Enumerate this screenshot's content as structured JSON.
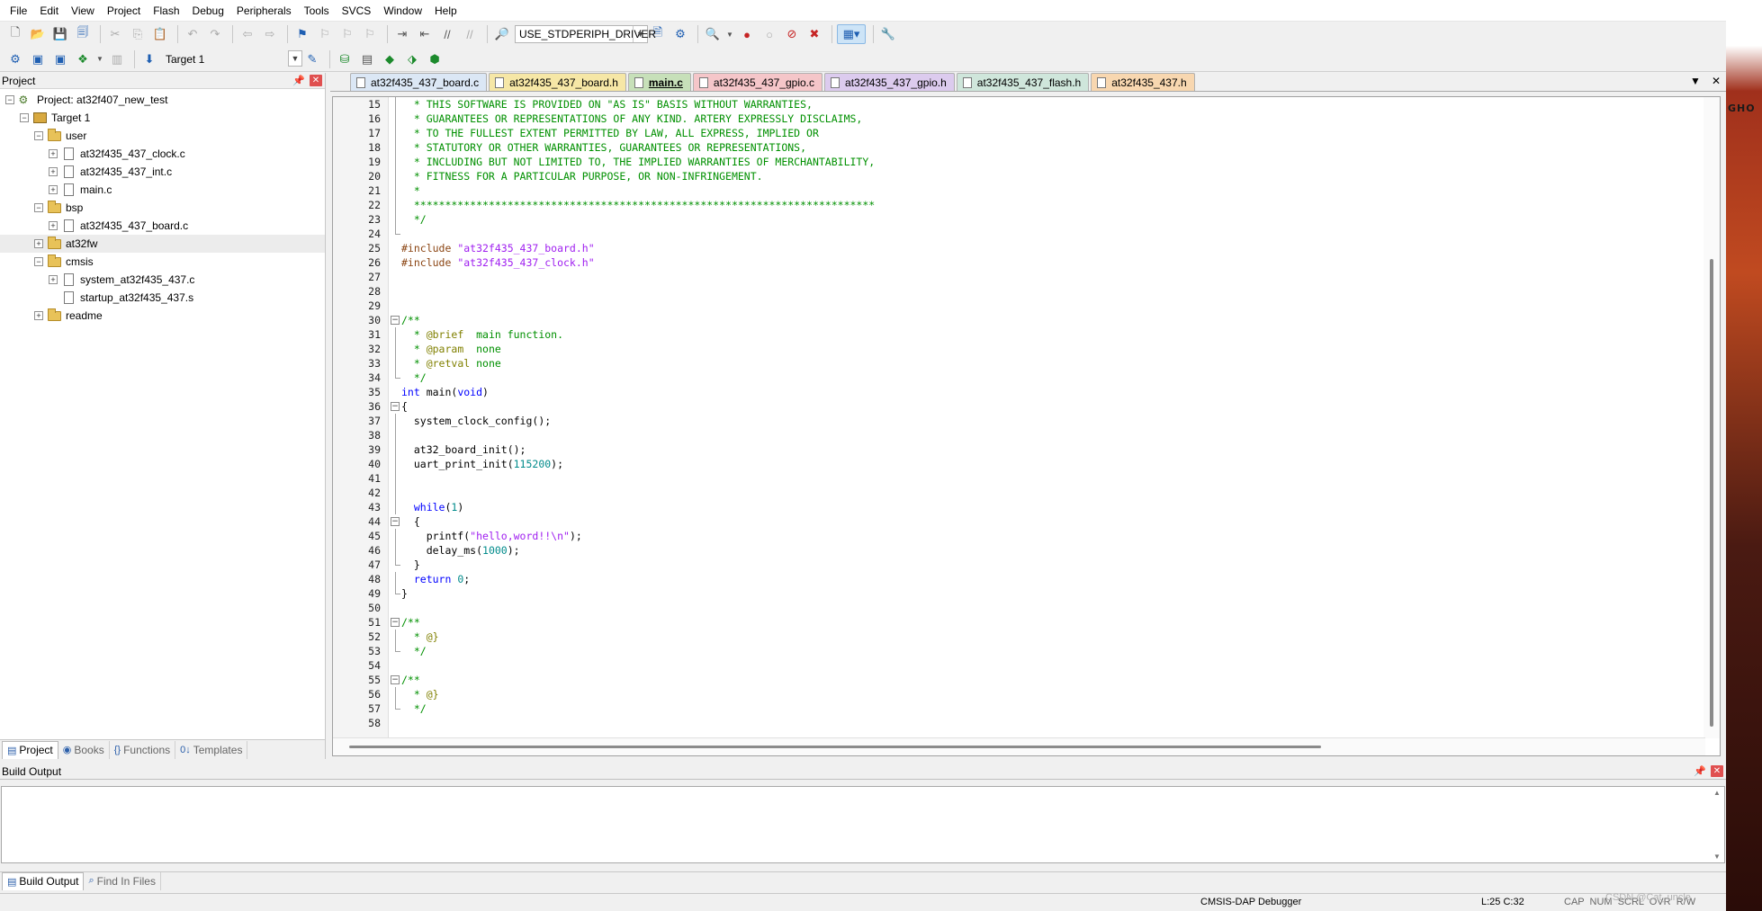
{
  "menubar": [
    "File",
    "Edit",
    "View",
    "Project",
    "Flash",
    "Debug",
    "Peripherals",
    "Tools",
    "SVCS",
    "Window",
    "Help"
  ],
  "toolbar": {
    "define_select": "USE_STDPERIPH_DRIVER",
    "target_select": "Target 1"
  },
  "project_panel": {
    "title": "Project",
    "tree": [
      {
        "label": "Project: at32f407_new_test",
        "depth": 0,
        "kind": "project",
        "expander": "−"
      },
      {
        "label": "Target 1",
        "depth": 1,
        "kind": "target",
        "expander": "−"
      },
      {
        "label": "user",
        "depth": 2,
        "kind": "folder",
        "expander": "−"
      },
      {
        "label": "at32f435_437_clock.c",
        "depth": 3,
        "kind": "file",
        "expander": "+"
      },
      {
        "label": "at32f435_437_int.c",
        "depth": 3,
        "kind": "file",
        "expander": "+"
      },
      {
        "label": "main.c",
        "depth": 3,
        "kind": "file",
        "expander": "+"
      },
      {
        "label": "bsp",
        "depth": 2,
        "kind": "folder",
        "expander": "−"
      },
      {
        "label": "at32f435_437_board.c",
        "depth": 3,
        "kind": "file",
        "expander": "+"
      },
      {
        "label": "at32fw",
        "depth": 2,
        "kind": "folder",
        "expander": "+"
      },
      {
        "label": "cmsis",
        "depth": 2,
        "kind": "folder",
        "expander": "−"
      },
      {
        "label": "system_at32f435_437.c",
        "depth": 3,
        "kind": "file",
        "expander": "+"
      },
      {
        "label": "startup_at32f435_437.s",
        "depth": 3,
        "kind": "file",
        "expander": ""
      },
      {
        "label": "readme",
        "depth": 2,
        "kind": "folder",
        "expander": "+"
      }
    ],
    "tabs": [
      {
        "label": "Project",
        "icon": "project-tab-icon",
        "icon_char": "▤"
      },
      {
        "label": "Books",
        "icon": "books-tab-icon",
        "icon_char": "◉"
      },
      {
        "label": "Functions",
        "icon": "functions-tab-icon",
        "icon_char": "{}"
      },
      {
        "label": "Templates",
        "icon": "templates-tab-icon",
        "icon_char": "0↓"
      }
    ]
  },
  "editor": {
    "tabs": [
      {
        "label": "at32f435_437_board.c",
        "color": "#dbe7f5"
      },
      {
        "label": "at32f435_437_board.h",
        "color": "#f6e7a6"
      },
      {
        "label": "main.c",
        "color": "#c7e0b9",
        "active": true
      },
      {
        "label": "at32f435_437_gpio.c",
        "color": "#f5c6c9"
      },
      {
        "label": "at32f435_437_gpio.h",
        "color": "#dccbee"
      },
      {
        "label": "at32f435_437_flash.h",
        "color": "#cfe6db"
      },
      {
        "label": "at32f435_437.h",
        "color": "#f8d7b0"
      }
    ],
    "lines": [
      {
        "n": "15",
        "code": "  * THIS SOFTWARE IS PROVIDED ON \"AS IS\" BASIS WITHOUT WARRANTIES,",
        "fold": "line"
      },
      {
        "n": "16",
        "code": "  * GUARANTEES OR REPRESENTATIONS OF ANY KIND. ARTERY EXPRESSLY DISCLAIMS,",
        "fold": "line"
      },
      {
        "n": "17",
        "code": "  * TO THE FULLEST EXTENT PERMITTED BY LAW, ALL EXPRESS, IMPLIED OR",
        "fold": "line"
      },
      {
        "n": "18",
        "code": "  * STATUTORY OR OTHER WARRANTIES, GUARANTEES OR REPRESENTATIONS,",
        "fold": "line"
      },
      {
        "n": "19",
        "code": "  * INCLUDING BUT NOT LIMITED TO, THE IMPLIED WARRANTIES OF MERCHANTABILITY,",
        "fold": "line"
      },
      {
        "n": "20",
        "code": "  * FITNESS FOR A PARTICULAR PURPOSE, OR NON-INFRINGEMENT.",
        "fold": "line"
      },
      {
        "n": "21",
        "code": "  *",
        "fold": "line"
      },
      {
        "n": "22",
        "code": "  **************************************************************************",
        "fold": "line"
      },
      {
        "n": "23",
        "code": "  */",
        "fold": "line"
      },
      {
        "n": "24",
        "code": "",
        "fold": "end"
      },
      {
        "n": "25",
        "code": "#include \"at32f435_437_board.h\"",
        "fold": ""
      },
      {
        "n": "26",
        "code": "#include \"at32f435_437_clock.h\"",
        "fold": ""
      },
      {
        "n": "27",
        "code": "",
        "fold": ""
      },
      {
        "n": "28",
        "code": "",
        "fold": ""
      },
      {
        "n": "29",
        "code": "",
        "fold": ""
      },
      {
        "n": "30",
        "code": "/**",
        "fold": "box"
      },
      {
        "n": "31",
        "code": "  * @brief  main function.",
        "fold": "line"
      },
      {
        "n": "32",
        "code": "  * @param  none",
        "fold": "line"
      },
      {
        "n": "33",
        "code": "  * @retval none",
        "fold": "line"
      },
      {
        "n": "34",
        "code": "  */",
        "fold": "end"
      },
      {
        "n": "35",
        "code": "int main(void)",
        "fold": ""
      },
      {
        "n": "36",
        "code": "{",
        "fold": "box"
      },
      {
        "n": "37",
        "code": "  system_clock_config();",
        "fold": "line"
      },
      {
        "n": "38",
        "code": "",
        "fold": "line"
      },
      {
        "n": "39",
        "code": "  at32_board_init();",
        "fold": "line"
      },
      {
        "n": "40",
        "code": "  uart_print_init(115200);",
        "fold": "line"
      },
      {
        "n": "41",
        "code": "",
        "fold": "line"
      },
      {
        "n": "42",
        "code": "",
        "fold": "line"
      },
      {
        "n": "43",
        "code": "  while(1)",
        "fold": "line"
      },
      {
        "n": "44",
        "code": "  {",
        "fold": "box"
      },
      {
        "n": "45",
        "code": "    printf(\"hello,word!!\\n\");",
        "fold": "line"
      },
      {
        "n": "46",
        "code": "    delay_ms(1000);",
        "fold": "line"
      },
      {
        "n": "47",
        "code": "  }",
        "fold": "end"
      },
      {
        "n": "48",
        "code": "  return 0;",
        "fold": "line"
      },
      {
        "n": "49",
        "code": "}",
        "fold": "end"
      },
      {
        "n": "50",
        "code": "",
        "fold": ""
      },
      {
        "n": "51",
        "code": "/**",
        "fold": "box"
      },
      {
        "n": "52",
        "code": "  * @}",
        "fold": "line"
      },
      {
        "n": "53",
        "code": "  */",
        "fold": "end"
      },
      {
        "n": "54",
        "code": "",
        "fold": ""
      },
      {
        "n": "55",
        "code": "/**",
        "fold": "box"
      },
      {
        "n": "56",
        "code": "  * @}",
        "fold": "line"
      },
      {
        "n": "57",
        "code": "  */",
        "fold": "end"
      },
      {
        "n": "58",
        "code": "",
        "fold": ""
      }
    ]
  },
  "build_output": {
    "title": "Build Output",
    "tabs": [
      {
        "label": "Build Output",
        "icon": "build-output-tab-icon",
        "icon_char": "▤"
      },
      {
        "label": "Find In Files",
        "icon": "find-in-files-tab-icon",
        "icon_char": "⌕"
      }
    ]
  },
  "statusbar": {
    "debugger": "CMSIS-DAP Debugger",
    "cursor": "L:25 C:32",
    "indicators": "CAP  NUM  SCRL  OVR  R/W"
  },
  "desktop": {
    "watermark": "CSDN @Cat_uncle",
    "logo_text": "GHO"
  }
}
